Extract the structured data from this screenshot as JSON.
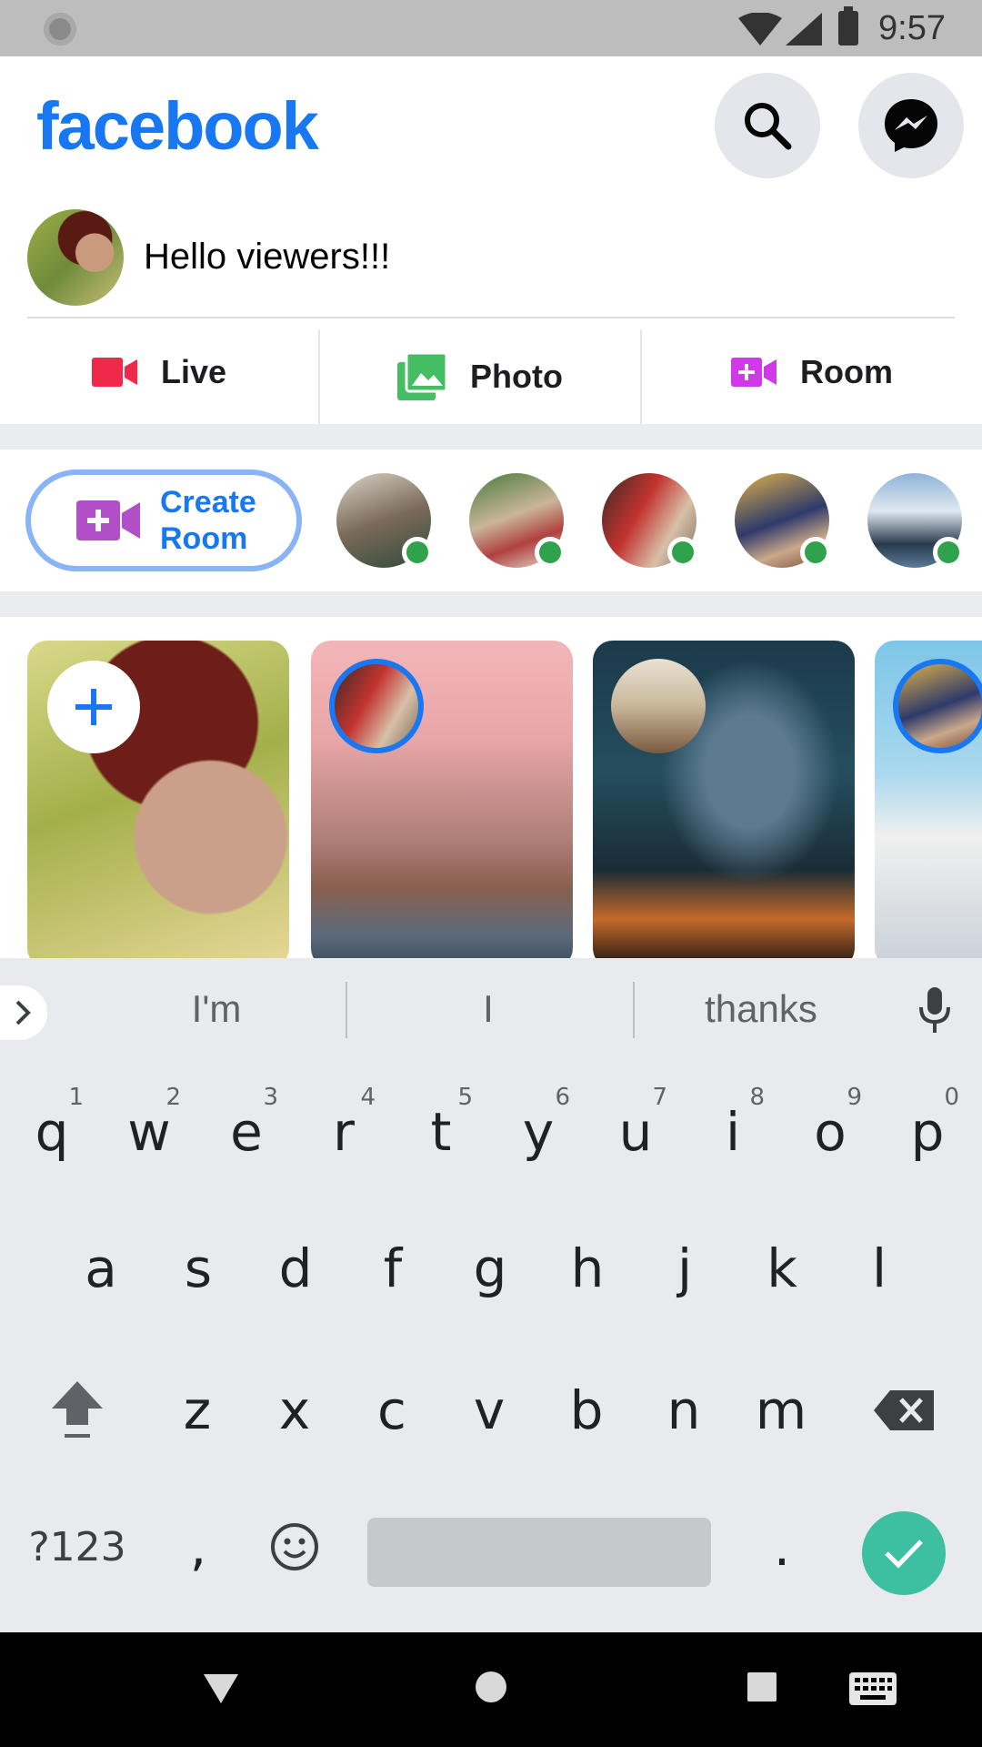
{
  "status_bar": {
    "time": "9:57"
  },
  "header": {
    "logo": "facebook",
    "search_icon": "search-icon",
    "messenger_icon": "messenger-icon"
  },
  "composer": {
    "text": "Hello viewers!!!"
  },
  "actions": {
    "live": "Live",
    "photo": "Photo",
    "room": "Room"
  },
  "rooms": {
    "create_room": "Create Room"
  },
  "keyboard": {
    "suggestions": [
      "I'm",
      "I",
      "thanks"
    ],
    "row1": [
      {
        "k": "q",
        "n": "1"
      },
      {
        "k": "w",
        "n": "2"
      },
      {
        "k": "e",
        "n": "3"
      },
      {
        "k": "r",
        "n": "4"
      },
      {
        "k": "t",
        "n": "5"
      },
      {
        "k": "y",
        "n": "6"
      },
      {
        "k": "u",
        "n": "7"
      },
      {
        "k": "i",
        "n": "8"
      },
      {
        "k": "o",
        "n": "9"
      },
      {
        "k": "p",
        "n": "0"
      }
    ],
    "row2": [
      "a",
      "s",
      "d",
      "f",
      "g",
      "h",
      "j",
      "k",
      "l"
    ],
    "row3": [
      "z",
      "x",
      "c",
      "v",
      "b",
      "n",
      "m"
    ],
    "symbols_key": "?123",
    "comma_key": ",",
    "period_key": "."
  },
  "colors": {
    "brand": "#1877f2",
    "online": "#31a24c",
    "live": "#f02849",
    "photo": "#45bd62",
    "room": "#d039e8",
    "enter": "#3dbfa1"
  }
}
